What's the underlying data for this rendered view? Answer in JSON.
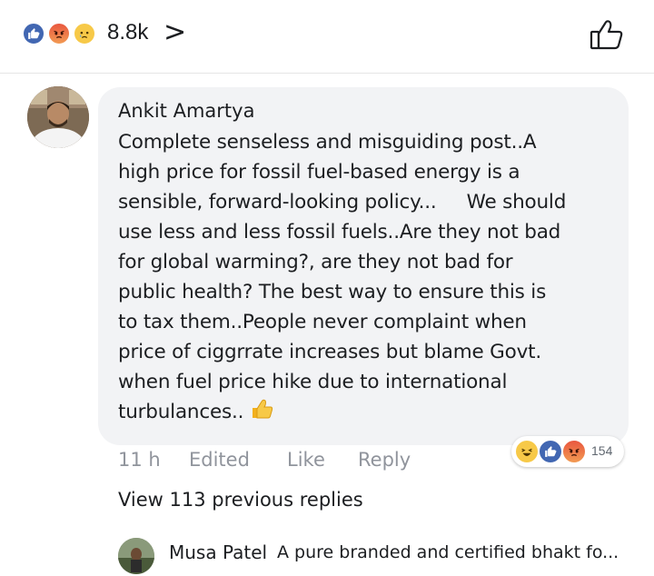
{
  "top_bar": {
    "reaction_count": "8.8k",
    "chevron": ">",
    "reactions": [
      "like-icon",
      "angry-icon",
      "sad-icon"
    ]
  },
  "comment": {
    "author": "Ankit Amartya",
    "lines": [
      "Complete senseless and misguiding post..A",
      "high price for fossil fuel-based energy is a",
      "sensible, forward-looking policy...     We should",
      "use less and less fossil fuels..Are they not bad",
      "for global warming?, are they not bad for",
      "public health? The best way to ensure this is",
      "to tax them..People never complaint when",
      "price of ciggrrate increases but blame Govt.",
      "when fuel price hike due to international",
      "turbulances.."
    ],
    "trailing_emoji": "thumbs-up-emoji",
    "time": "11 h",
    "edited_label": "Edited",
    "like_label": "Like",
    "reply_label": "Reply",
    "reaction_count": "154",
    "reactions": [
      "haha-icon",
      "like-icon",
      "angry-icon"
    ]
  },
  "replies": {
    "view_more_label": "View 113 previous replies",
    "latest": {
      "author": "Musa Patel",
      "text": "A pure branded and certified bhakt fo..."
    }
  },
  "colors": {
    "like_blue": "#4267b2",
    "bubble_bg": "#f2f3f5",
    "meta_gray": "#90949c",
    "text_dark": "#1c1e21"
  }
}
